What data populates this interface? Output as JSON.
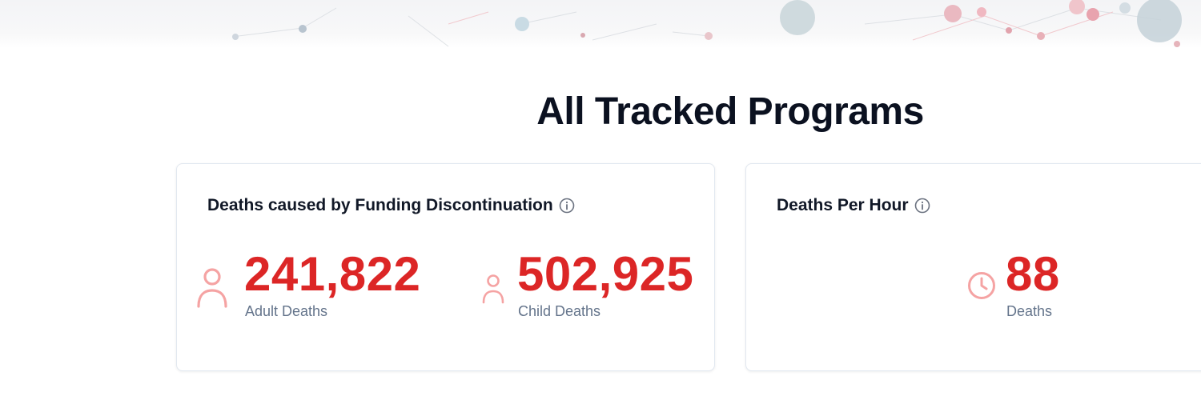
{
  "page": {
    "title": "All Tracked Programs"
  },
  "funding_card": {
    "title": "Deaths caused by Funding Discontinuation",
    "info_icon": "info-circle-icon",
    "stats": [
      {
        "value": "241,822",
        "label": "Adult Deaths",
        "icon": "adult-person-icon"
      },
      {
        "value": "502,925",
        "label": "Child Deaths",
        "icon": "child-person-icon"
      }
    ]
  },
  "per_hour_card": {
    "title": "Deaths Per Hour",
    "info_icon": "info-circle-icon",
    "stat": {
      "value": "88",
      "label": "Deaths",
      "icon": "clock-icon"
    }
  },
  "colors": {
    "accent": "#dc2626",
    "icon_tint": "#f5a3a3",
    "label": "#64748b",
    "heading": "#0b1120",
    "card_border": "#e2e8f0"
  }
}
